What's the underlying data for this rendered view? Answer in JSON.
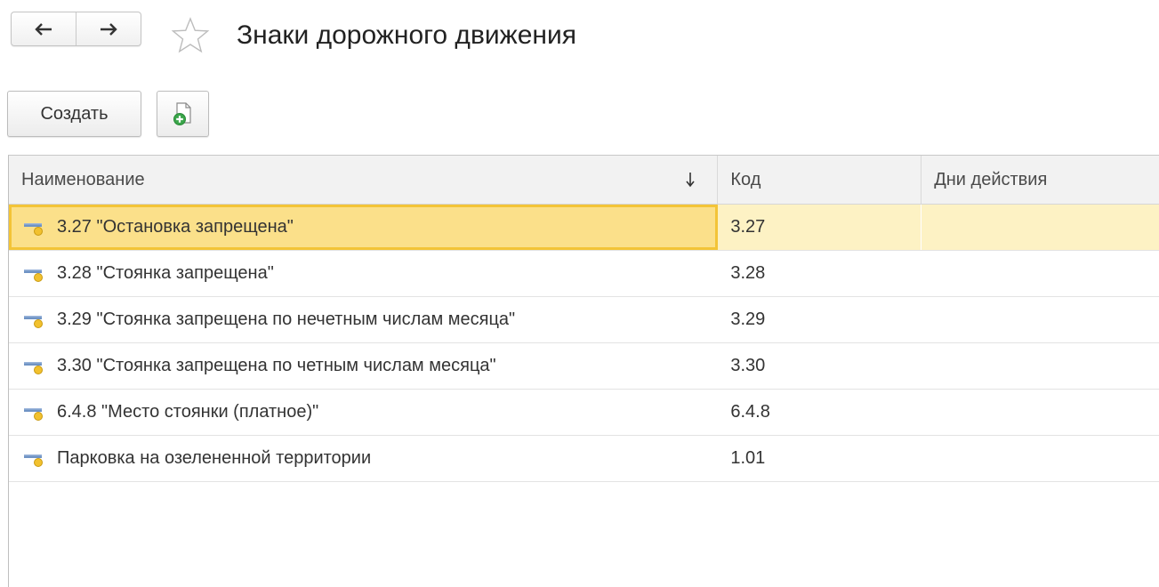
{
  "header": {
    "back_icon": "arrow-left-icon",
    "forward_icon": "arrow-right-icon",
    "favorite_icon": "star-outline-icon",
    "title": "Знаки дорожного движения"
  },
  "toolbar": {
    "create_label": "Создать",
    "copy_icon": "copy-document-plus-icon"
  },
  "table": {
    "columns": [
      {
        "label": "Наименование",
        "sort": "descending"
      },
      {
        "label": "Код"
      },
      {
        "label": "Дни действия"
      }
    ],
    "rows": [
      {
        "name": "3.27 \"Остановка запрещена\"",
        "code": "3.27",
        "days": "",
        "selected": true
      },
      {
        "name": "3.28 \"Стоянка запрещена\"",
        "code": "3.28",
        "days": ""
      },
      {
        "name": "3.29 \"Стоянка запрещена по нечетным числам месяца\"",
        "code": "3.29",
        "days": ""
      },
      {
        "name": "3.30 \"Стоянка запрещена по четным числам месяца\"",
        "code": "3.30",
        "days": ""
      },
      {
        "name": "6.4.8 \"Место стоянки (платное)\"",
        "code": "6.4.8",
        "days": ""
      },
      {
        "name": "Парковка на озелененной территории",
        "code": "1.01",
        "days": ""
      }
    ],
    "row_icon": "catalog-item-icon"
  },
  "colors": {
    "selection_fill": "#fdf2c4",
    "selection_cell": "#fbe08a",
    "selection_border": "#f3c437",
    "icon_blue": "#6f93c4",
    "icon_yellow": "#f2c12e",
    "add_green": "#3aa54a"
  }
}
